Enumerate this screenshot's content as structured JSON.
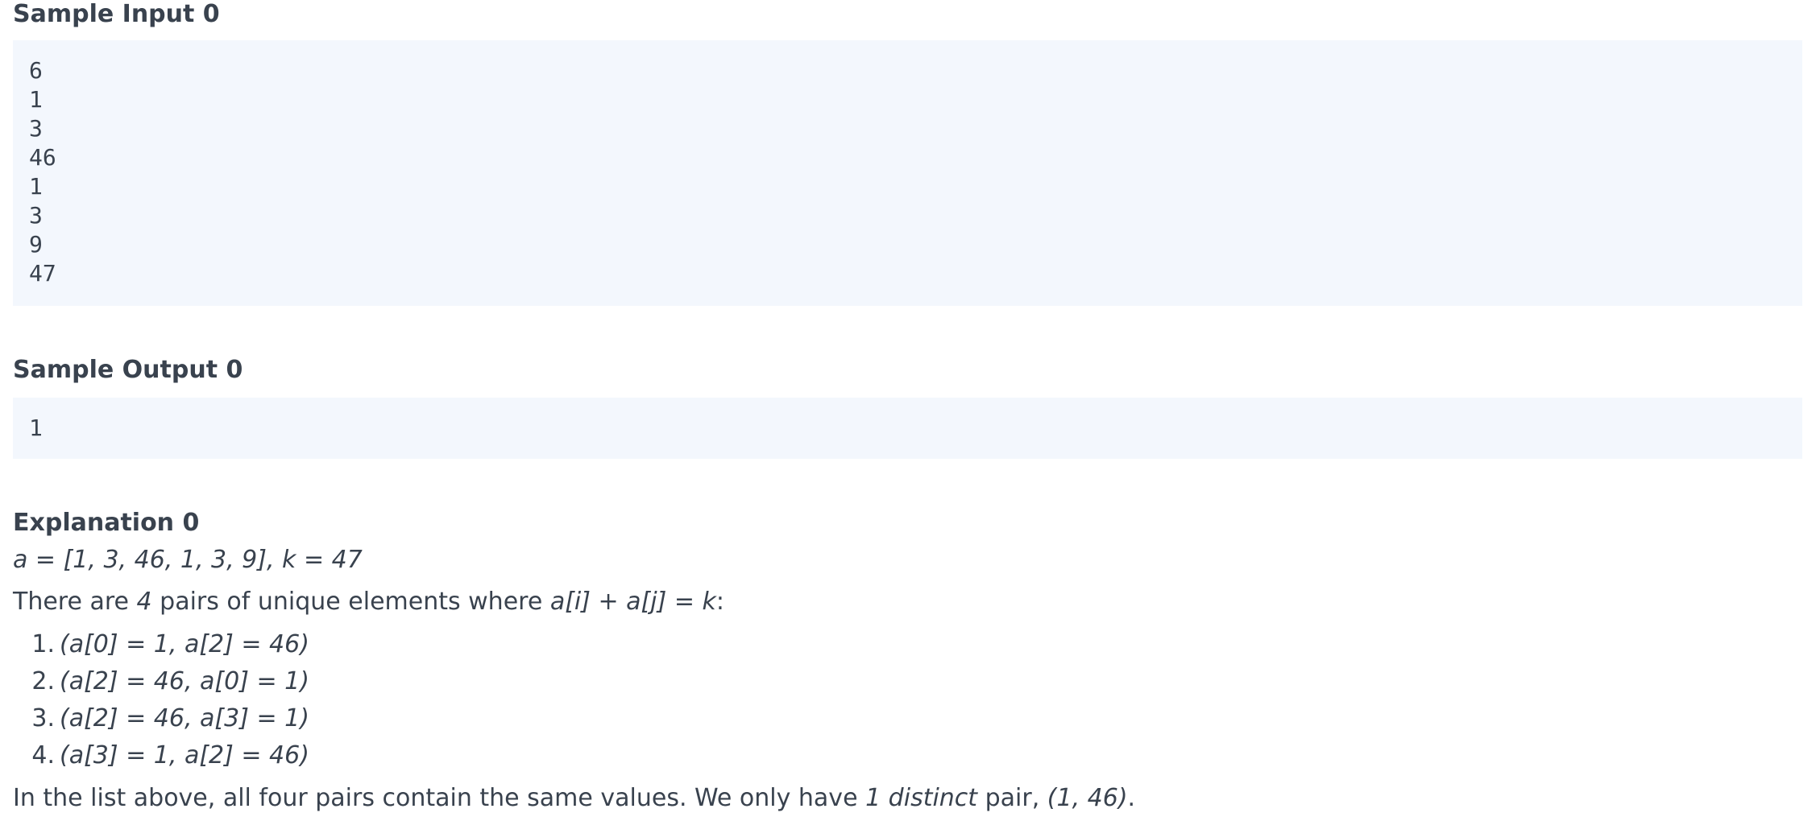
{
  "sample_input": {
    "heading": "Sample Input 0",
    "lines": [
      "6",
      "1",
      "3",
      "46",
      "1",
      "3",
      "9",
      "47"
    ]
  },
  "sample_output": {
    "heading": "Sample Output 0",
    "lines": [
      "1"
    ]
  },
  "explanation": {
    "heading": "Explanation 0",
    "formula": "a = [1, 3, 46, 1, 3, 9], k = 47",
    "intro": {
      "prefix": "There are ",
      "count": "4",
      "middle": " pairs of unique elements where ",
      "expr": "a[i] + a[j] = k",
      "suffix": ":"
    },
    "pairs": [
      {
        "num": "1.",
        "text": "(a[0] = 1, a[2] = 46)"
      },
      {
        "num": "2.",
        "text": "(a[2] = 46, a[0] = 1)"
      },
      {
        "num": "3.",
        "text": "(a[2] = 46, a[3] = 1)"
      },
      {
        "num": "4.",
        "text": "(a[3] = 1, a[2] = 46)"
      }
    ],
    "conclusion": {
      "prefix": "In the list above, all four pairs contain the same values. We only have ",
      "distinct": "1 distinct",
      "middle": " pair, ",
      "pair": "(1, 46)",
      "suffix": "."
    }
  }
}
